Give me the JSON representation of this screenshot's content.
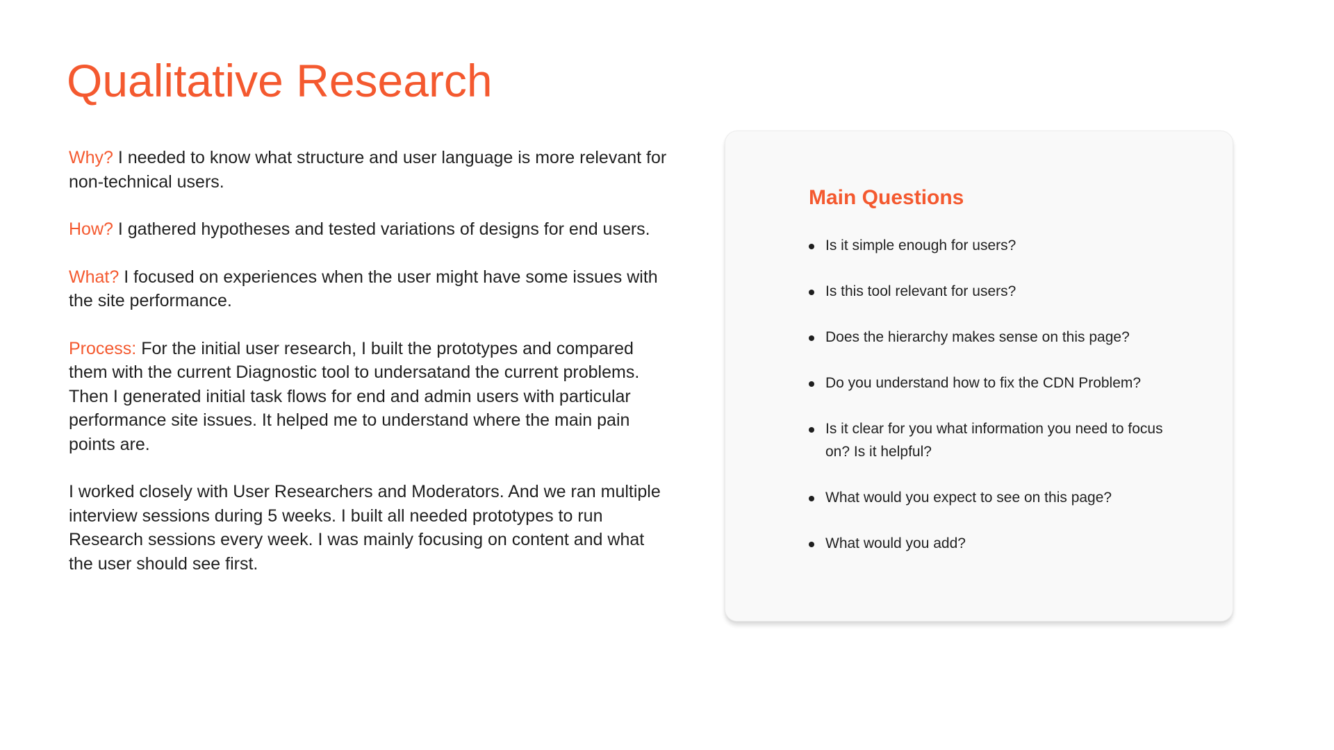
{
  "title": "Qualitative Research",
  "paragraphs": [
    {
      "lead": "Why?",
      "text": " I needed to know what structure and user language is more relevant for non-technical users."
    },
    {
      "lead": "How?",
      "text": " I gathered hypotheses and tested variations of designs for end users."
    },
    {
      "lead": "What?",
      "text": " I focused on experiences when the user might have some issues with the site performance."
    },
    {
      "lead": "Process:",
      "text": " For the initial user research, I built the prototypes and compared them with the current Diagnostic tool to undersatand the current problems. Then I generated initial task flows for end and admin users with particular performance site issues. It helped me to understand where the main pain points are."
    },
    {
      "lead": "",
      "text": "I worked closely with User Researchers and Moderators. And we ran multiple interview sessions during 5 weeks. I built all needed prototypes to run Research sessions every week. I was mainly focusing on content and what the user should see first."
    }
  ],
  "questions_card": {
    "title": "Main Questions",
    "items": [
      "Is it simple enough for users?",
      "Is this tool relevant for users?",
      "Does the hierarchy makes sense on this page?",
      "Do you understand how to fix the CDN Problem?",
      "Is it clear for you what information you need to focus on? Is it helpful?",
      "What would you expect to see on this page?",
      "What would you add?"
    ]
  },
  "colors": {
    "accent": "#f4592f",
    "text": "#1f1f1f",
    "card_background": "#f9f9f9"
  }
}
